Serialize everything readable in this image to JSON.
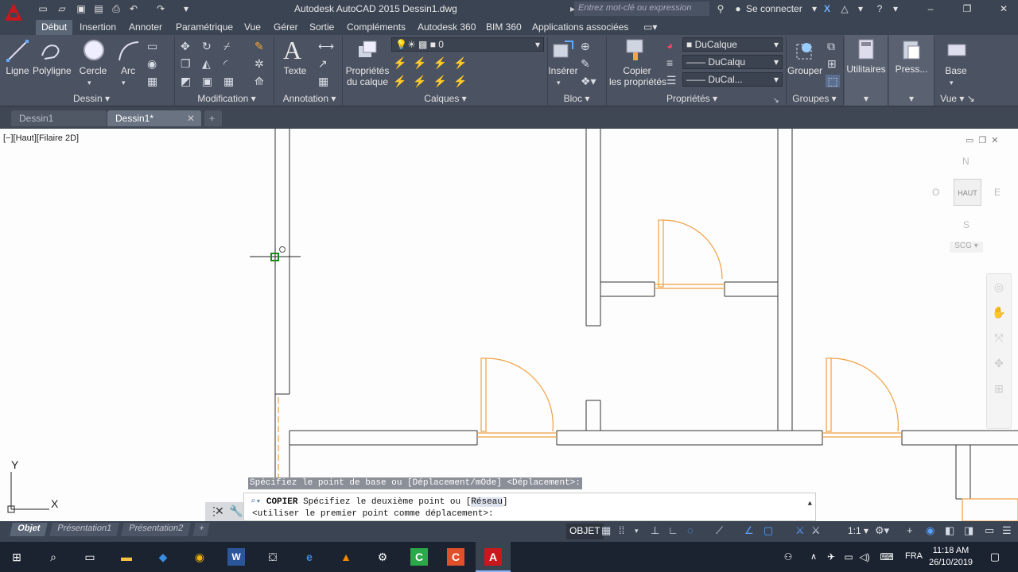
{
  "window": {
    "title": "Autodesk AutoCAD 2015    Dessin1.dwg",
    "search_placeholder": "Entrez mot-clé ou expression",
    "signin": "Se connecter"
  },
  "ribbon_tabs": [
    "Début",
    "Insertion",
    "Annoter",
    "Paramétrique",
    "Vue",
    "Gérer",
    "Sortie",
    "Compléments",
    "Autodesk 360",
    "BIM 360",
    "Applications associées"
  ],
  "ribbon": {
    "draw": {
      "ligne": "Ligne",
      "polyligne": "Polyligne",
      "cercle": "Cercle",
      "arc": "Arc",
      "title": "Dessin"
    },
    "modify": {
      "title": "Modification"
    },
    "annotation": {
      "texte": "Texte",
      "title": "Annotation"
    },
    "layers": {
      "props_line1": "Propriétés",
      "props_line2": "du calque",
      "current_layer": "0",
      "title": "Calques"
    },
    "block": {
      "inserer": "Insérer",
      "title": "Bloc"
    },
    "properties": {
      "copy_line1": "Copier",
      "copy_line2": "les propriétés",
      "color": "DuCalque",
      "linetype": "DuCalqu",
      "lineweight": "DuCal...",
      "title": "Propriétés"
    },
    "groups": {
      "grouper": "Grouper",
      "title": "Groupes"
    },
    "utilities": {
      "label": "Utilitaires"
    },
    "clipboard": {
      "label": "Press..."
    },
    "view": {
      "base": "Base",
      "title": "Vue"
    }
  },
  "doc_tabs": [
    "Dessin1",
    "Dessin1*"
  ],
  "viewport": {
    "label": "[−][Haut][Filaire 2D]",
    "viewcube": {
      "n": "N",
      "s": "S",
      "e": "E",
      "w": "O",
      "face": "HAUT",
      "ucs": "SCG"
    },
    "ucs_x": "X",
    "ucs_y": "Y"
  },
  "command": {
    "prompt": "Spécifiez le point de base ou [Déplacement/mOde] <Déplacement>:",
    "line1_cmd": "COPIER",
    "line1_text": "Spécifiez le deuxième point ou [",
    "line1_opt": "Réseau",
    "line1_end": "]",
    "line2": "<utiliser le premier point comme déplacement>:"
  },
  "layout_tabs": [
    "Objet",
    "Présentation1",
    "Présentation2"
  ],
  "status": {
    "objet": "OBJET",
    "scale": "1:1"
  },
  "taskbar": {
    "lang": "FRA",
    "time": "11:18 AM",
    "date": "26/10/2019"
  },
  "colors": {
    "door": "#f0a040",
    "wall": "#333333",
    "cursor": "#1a8a1a",
    "ribbon": "#4b5261"
  }
}
